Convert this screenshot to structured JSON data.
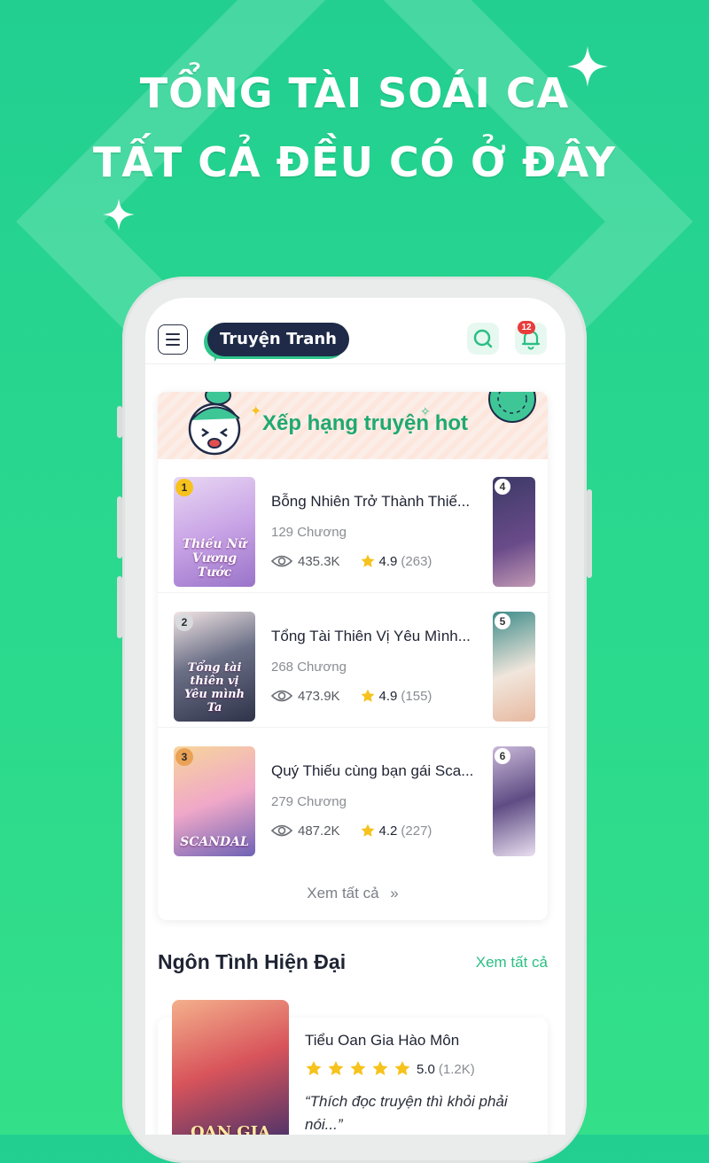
{
  "promo": {
    "line1": "TỔNG TÀI SOÁI CA",
    "line2": "TẤT CẢ ĐỀU CÓ Ở ĐÂY"
  },
  "app": {
    "logo_text": "Truyện Tranh",
    "notification_count": "12"
  },
  "hot_ranking": {
    "title": "Xếp hạng truyện hot",
    "see_all": "Xem tất cả",
    "items": [
      {
        "rank": "1",
        "title": "Bỗng Nhiên Trở Thành Thiế...",
        "chapters": "129 Chương",
        "views": "435.3K",
        "rating": "4.9",
        "rating_count": "(263)",
        "cover_text": "Thiếu Nữ Vương Tước",
        "side_rank": "4"
      },
      {
        "rank": "2",
        "title": "Tổng Tài Thiên Vị Yêu Mình...",
        "chapters": "268 Chương",
        "views": "473.9K",
        "rating": "4.9",
        "rating_count": "(155)",
        "cover_text": "Tổng tài thiên vị Yêu mình Ta",
        "side_rank": "5"
      },
      {
        "rank": "3",
        "title": "Quý Thiếu cùng bạn gái Sca...",
        "chapters": "279 Chương",
        "views": "487.2K",
        "rating": "4.2",
        "rating_count": "(227)",
        "cover_text": "SCANDAL",
        "side_rank": "6"
      }
    ]
  },
  "section": {
    "title": "Ngôn Tình Hiện Đại",
    "more": "Xem tất cả"
  },
  "featured": {
    "title": "Tiểu Oan Gia Hào Môn",
    "rating": "5.0",
    "rating_count": "(1.2K)",
    "quote": "“Thích đọc truyện thì khỏi phải nói...”",
    "cover_text": "OAN GIA"
  },
  "colors": {
    "brand_green": "#2bbf84",
    "navy": "#1e2a47",
    "badge_red": "#ea3b3b",
    "star": "#f6c21c"
  }
}
